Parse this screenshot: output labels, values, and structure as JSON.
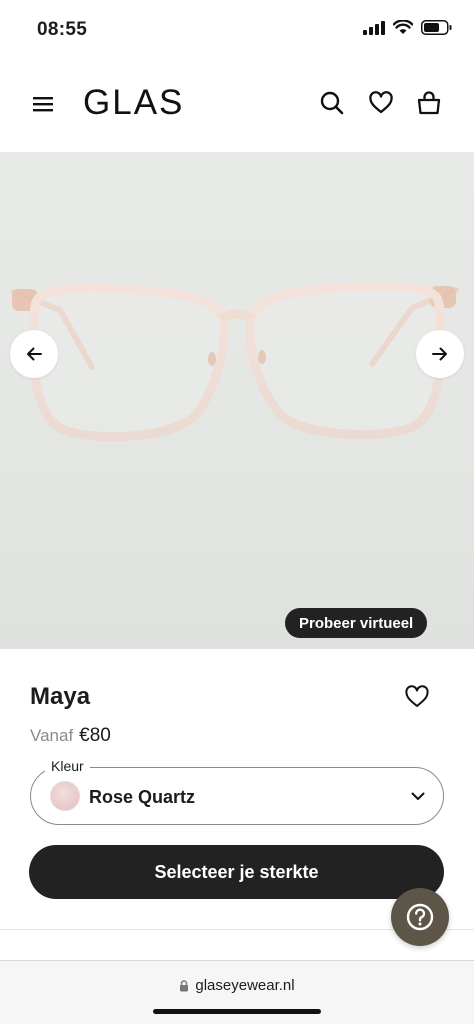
{
  "status_bar": {
    "time": "08:55"
  },
  "header": {
    "logo": "GLAS"
  },
  "gallery": {
    "try_on_label": "Probeer virtueel"
  },
  "product": {
    "name": "Maya",
    "price_prefix": "Vanaf",
    "price": "€80",
    "color_label": "Kleur",
    "color_value": "Rose Quartz",
    "cta_label": "Selecteer je sterkte"
  },
  "browser": {
    "url": "glaseyewear.nl"
  },
  "colors": {
    "dark": "#222222",
    "help_button": "#5e5549",
    "swatch": "#e7c8c8",
    "gallery_bg": "#e5e7e4"
  },
  "icons": [
    "signal-icon",
    "wifi-icon",
    "battery-icon",
    "menu-icon",
    "search-icon",
    "heart-icon",
    "bag-icon",
    "arrow-left-icon",
    "arrow-right-icon",
    "chevron-down-icon",
    "help-icon",
    "lock-icon"
  ]
}
